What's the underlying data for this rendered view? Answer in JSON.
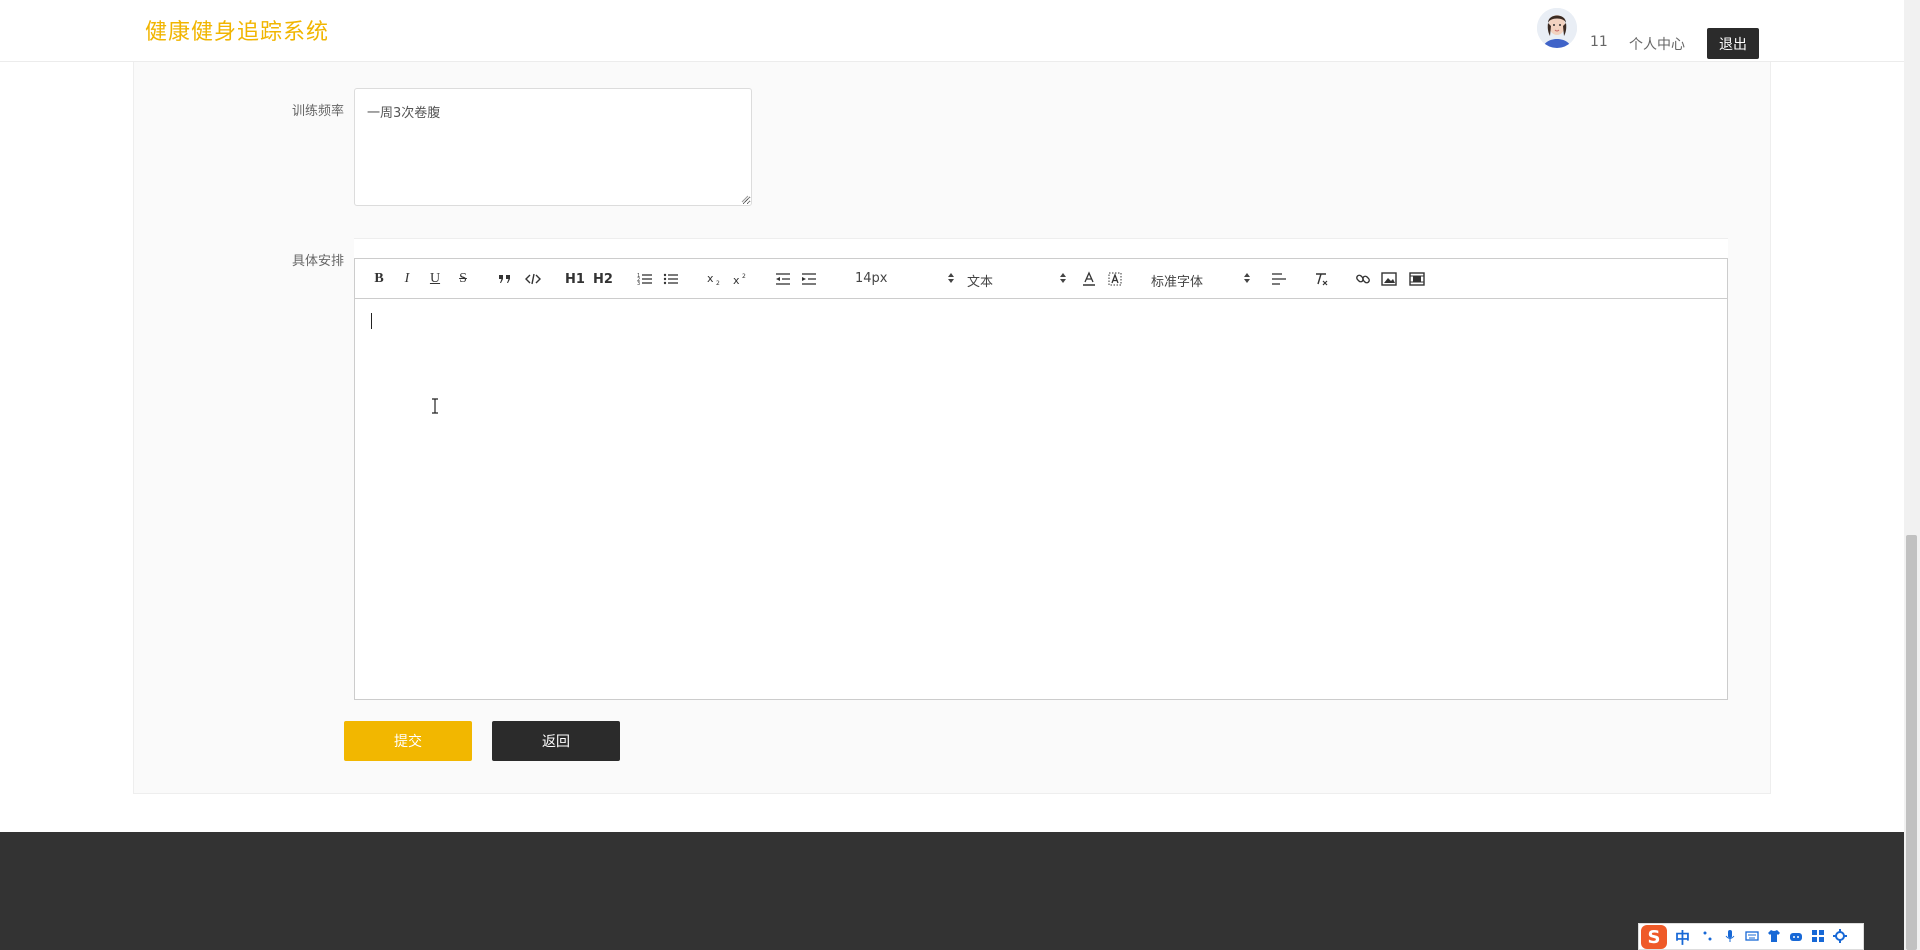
{
  "header": {
    "brand": "健康健身追踪系统",
    "username": "11",
    "user_center": "个人中心",
    "logout": "退出"
  },
  "form": {
    "frequency": {
      "label": "训练频率",
      "value": "一周3次卷腹"
    },
    "schedule": {
      "label": "具体安排",
      "value": ""
    },
    "submit": "提交",
    "back": "返回"
  },
  "editor": {
    "toolbar": {
      "bold": "B",
      "italic": "I",
      "underline": "U",
      "strike": "S",
      "h1": "H1",
      "h2": "H2",
      "font_size": "14px",
      "header_picker": "文本",
      "font_family": "标准字体"
    }
  },
  "ime": {
    "mode": "中"
  }
}
